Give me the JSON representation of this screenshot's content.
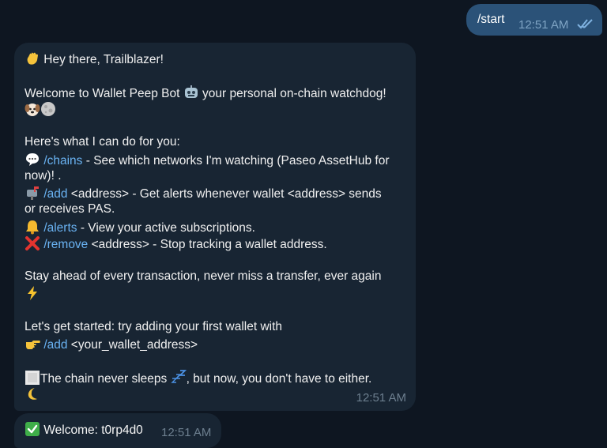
{
  "outgoing": {
    "text": "/start",
    "time": "12:51 AM"
  },
  "welcome": {
    "greeting": " Hey there, Trailblazer!",
    "intro_a": "Welcome to Wallet Peep Bot",
    "intro_b": " your personal on-chain watchdog!",
    "help_heading": "Here's what I can do for you:",
    "chains_cmd": "/chains",
    "chains_desc_1": " - See which networks I'm watching (Paseo AssetHub for",
    "chains_desc_2": "now)! .",
    "add_cmd": "/add",
    "add_desc_1": " <address> - Get alerts whenever wallet <address> sends",
    "add_desc_2": "or receives PAS.",
    "alerts_cmd": "/alerts",
    "alerts_desc": " - View your active subscriptions.",
    "remove_cmd": "/remove",
    "remove_desc": " <address> - Stop tracking a wallet address.",
    "stay_ahead": "Stay ahead of every transaction, never miss a transfer, ever again",
    "get_started": "Let's get started: try adding your first wallet with",
    "start_cmd": "/add",
    "start_arg": " <your_wallet_address>",
    "chain_sleeps_a": "The chain never sleeps ",
    "chain_sleeps_b": ", but now, you don't have to either.",
    "time": "12:51 AM"
  },
  "second": {
    "text": " Welcome: t0rp4d0",
    "time": "12:51 AM"
  },
  "icons": {
    "wave": "waving-hand",
    "robot": "robot-face",
    "dog": "dog-face",
    "moon": "full-moon",
    "speech": "speech-balloon",
    "mailbox": "mailbox",
    "bell": "bell",
    "cross": "cross-mark",
    "zap": "high-voltage",
    "point": "pointing-right",
    "square": "white-square",
    "zzz": "zzz",
    "crescent": "crescent-moon",
    "check": "check-mark-button"
  },
  "colors": {
    "background": "#0e1621",
    "outgoing_bubble": "#2b5278",
    "incoming_bubble": "#182533",
    "link": "#6ab3f3"
  }
}
